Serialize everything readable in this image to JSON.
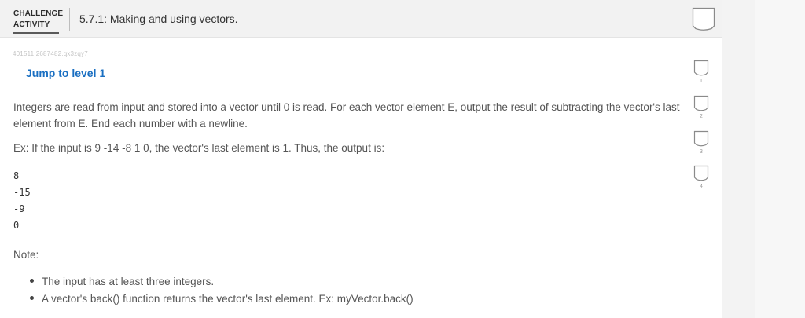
{
  "header": {
    "activity_type_line1": "CHALLENGE",
    "activity_type_line2": "ACTIVITY",
    "title": "5.7.1: Making and using vectors."
  },
  "activity_id": "401511.2687482.qx3zqy7",
  "jump_link": "Jump to level 1",
  "instructions": {
    "p1": "Integers are read from input and stored into a vector until 0 is read. For each vector element E, output the result of subtracting the vector's last element from E. End each number with a newline.",
    "p2": "Ex: If the input is 9 -14 -8 1 0, the vector's last element is 1. Thus, the output is:"
  },
  "output_lines": [
    "8",
    "-15",
    "-9",
    "0"
  ],
  "note": {
    "label": "Note:",
    "bullets": [
      "The input has at least three integers.",
      "A vector's back() function returns the vector's last element. Ex: myVector.back()"
    ]
  },
  "levels": [
    {
      "number": "1"
    },
    {
      "number": "2"
    },
    {
      "number": "3"
    },
    {
      "number": "4"
    }
  ],
  "icons": {
    "header_check": "completion-checkbox-icon",
    "level_check": "level-checkbox-icon"
  },
  "colors": {
    "link": "#1a6fc2",
    "header_bg": "#f2f2f2"
  }
}
